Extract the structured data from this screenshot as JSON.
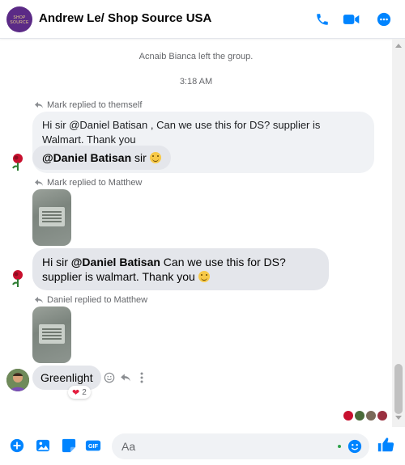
{
  "header": {
    "title": "Andrew Le/ Shop Source USA",
    "avatar_logo_text": "SHOP SOURCE",
    "actions": [
      "phone-icon",
      "video-call-icon",
      "more-options-icon"
    ],
    "accent_color": "#0084ff"
  },
  "conversation": {
    "system_message": "Acnaib Bianca left the group.",
    "timestamp": "3:18 AM",
    "messages": [
      {
        "reply_note": "Mark replied to themself",
        "quoted": {
          "prefix": "Hi sir @Daniel Batisan , Can we use this for DS? supplier is Walmart. Thank you"
        },
        "bubble": {
          "mention": "@Daniel Batisan",
          "suffix": " sir"
        }
      },
      {
        "reply_note": "Mark replied to Matthew",
        "bubble": {
          "prefix": "Hi sir ",
          "mention": "@Daniel Batisan",
          "suffix": "  Can we use this for DS? supplier is walmart. Thank you"
        }
      },
      {
        "reply_note": "Daniel replied to Matthew",
        "bubble": {
          "text": "Greenlight"
        },
        "reaction": {
          "emoji": "heart",
          "count": "2"
        }
      }
    ]
  },
  "composer": {
    "placeholder": "Aa",
    "tools": [
      "add-icon",
      "image-icon",
      "sticker-icon",
      "gif-icon"
    ],
    "gif_label": "GIF",
    "send_reaction": "thumbs-up-icon"
  }
}
